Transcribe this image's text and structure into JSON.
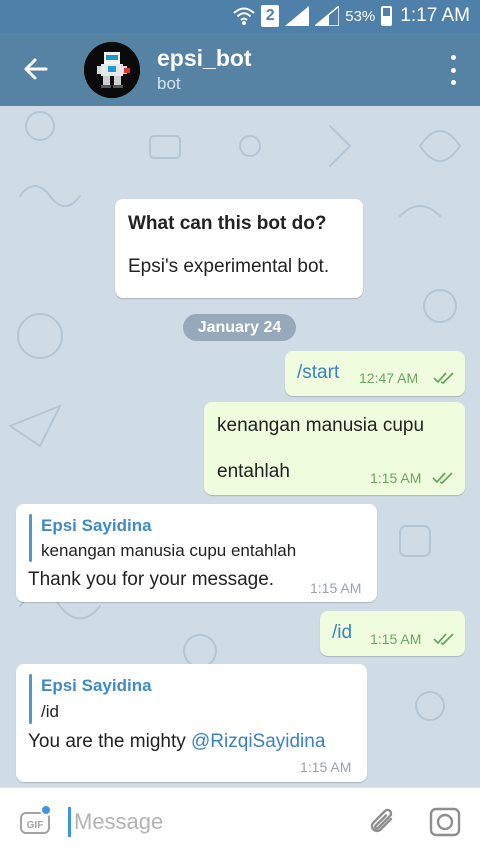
{
  "status_bar": {
    "sim": "2",
    "battery_percent": "53%",
    "time": "1:17 AM"
  },
  "header": {
    "title": "epsi_bot",
    "subtitle": "bot",
    "back_icon": "arrow-left-icon",
    "menu_icon": "more-vertical-icon"
  },
  "bot_info": {
    "title": "What can this bot do?",
    "description": "Epsi's experimental bot."
  },
  "date_separator": "January 24",
  "messages": [
    {
      "direction": "out",
      "text": "/start",
      "time": "12:47 AM",
      "read": true
    },
    {
      "direction": "out",
      "text_line1": "kenangan manusia cupu",
      "text_line2": "entahlah",
      "time": "1:15 AM",
      "read": true
    },
    {
      "direction": "in",
      "reply_name": "Epsi Sayidina",
      "reply_text": "kenangan manusia cupu  entahlah",
      "text": "Thank you for your message.",
      "time": "1:15 AM"
    },
    {
      "direction": "out",
      "text": "/id",
      "time": "1:15 AM",
      "read": true
    },
    {
      "direction": "in",
      "reply_name": "Epsi Sayidina",
      "reply_text": "/id",
      "text_prefix": "You are the mighty ",
      "mention": "@RizqiSayidina",
      "time": "1:15 AM"
    }
  ],
  "input": {
    "placeholder": "Message",
    "value": "",
    "gif_label": "GIF",
    "attach_icon": "paperclip-icon",
    "camera_icon": "camera-icon"
  },
  "colors": {
    "header": "#5682a3",
    "status_bar": "#4f80aa",
    "outgoing_bubble": "#effdde",
    "incoming_bubble": "#ffffff",
    "link": "#3b81c6",
    "chat_background": "#cfdce6"
  }
}
